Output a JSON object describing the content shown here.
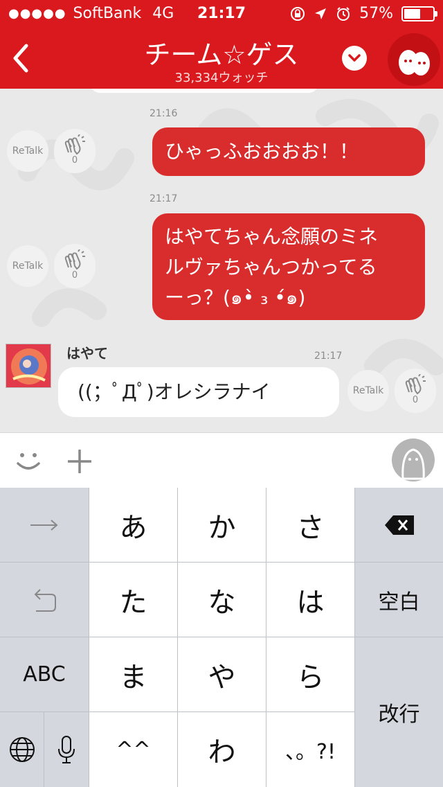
{
  "status_bar": {
    "signal_dots": "●●●●●",
    "carrier": "SoftBank",
    "network": "4G",
    "time": "21:17",
    "battery_text": "57%",
    "battery_level": 0.57
  },
  "header": {
    "title": "チーム☆ゲス",
    "watchers": "33,334ウォッチ",
    "accent_color": "#d9191e"
  },
  "messages": [
    {
      "direction": "out",
      "time": "21:16",
      "text": "ひゃっふおおおお！！",
      "retalk_label": "ReTalk",
      "clap_count": "0"
    },
    {
      "direction": "out",
      "time": "21:17",
      "lines": [
        "はやてちゃん念願のミネ",
        "ルヴァちゃんつかってる",
        "ーっ？(๑•̀ ₃ •́๑)"
      ],
      "retalk_label": "ReTalk",
      "clap_count": "0"
    },
    {
      "direction": "in",
      "sender": "はやて",
      "time": "21:17",
      "text": "((；ﾟДﾟ)オレシラナイ",
      "retalk_label": "ReTalk",
      "clap_count": "0"
    }
  ],
  "keyboard": {
    "row1": [
      "→",
      "あ",
      "か",
      "さ",
      "⌫"
    ],
    "row2": [
      "↺",
      "た",
      "な",
      "は",
      "空白"
    ],
    "row3": [
      "ABC",
      "ま",
      "や",
      "ら"
    ],
    "row4": [
      "🌐",
      "🎤",
      "^^",
      "わ",
      "、。?!"
    ],
    "enter": "改行"
  }
}
